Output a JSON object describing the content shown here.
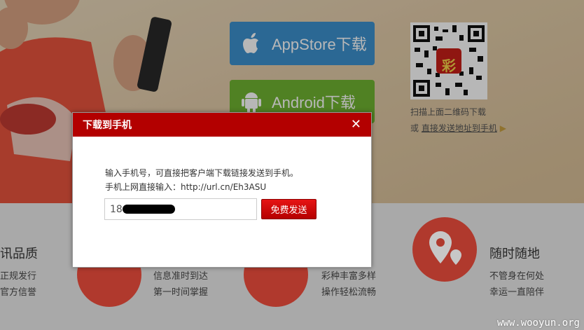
{
  "stores": {
    "appstore_label": "AppStore下载",
    "android_label": "Android下载"
  },
  "qr": {
    "caption": "扫描上面二维码下载",
    "link_prefix": "或",
    "link_text": "直接发送地址到手机",
    "center_char": "彩"
  },
  "features": [
    {
      "title": "讯品质",
      "lines": [
        "正规发行",
        "官方信誉"
      ]
    },
    {
      "lines": [
        "信息准时到达",
        "第一时间掌握"
      ]
    },
    {
      "lines": [
        "彩种丰富多样",
        "操作轻松流畅"
      ]
    },
    {
      "title": "随时随地",
      "lines": [
        "不管身在何处",
        "幸运一直陪伴"
      ]
    }
  ],
  "modal": {
    "title": "下载到手机",
    "close": "✕",
    "line1": "输入手机号，可直接把客户端下载链接发送到手机。",
    "line2": "手机上网直接输入：http://url.cn/Eh3ASU",
    "phone_value": "18",
    "send_label": "免费发送"
  },
  "watermark": "www.wooyun.org",
  "colors": {
    "modal_header": "#b30000",
    "appstore_blue": "#3d92cf",
    "android_green": "#70b532",
    "feature_red": "#e24a3a"
  }
}
